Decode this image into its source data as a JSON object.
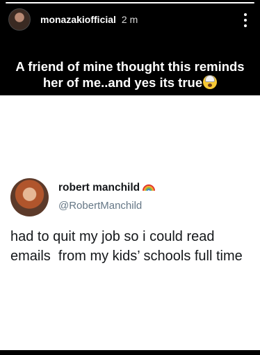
{
  "story": {
    "progress_fraction": 1,
    "username": "monazakiofficial",
    "time": "2 m",
    "more_icon": "more-vertical-icon",
    "caption_line1": "A friend of mine thought this reminds",
    "caption_line2": "her of me..and yes its true",
    "caption_emoji": "shocked-face-emoji"
  },
  "tweet": {
    "author_name": "robert manchild",
    "author_badge": "rainbow-icon",
    "handle": "@RobertManchild",
    "text": "had to quit my job so i could read emails  from my kids’ schools full time"
  }
}
